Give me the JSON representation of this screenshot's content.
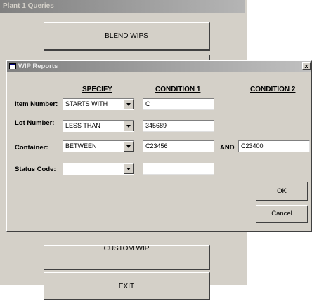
{
  "plant_window": {
    "title": "Plant 1 Queries",
    "buttons": {
      "blend_wips": "BLEND WIPS",
      "custom_wip": "CUSTOM WIP",
      "exit": "EXIT"
    }
  },
  "wip_window": {
    "title": "WIP Reports",
    "close_glyph": "x",
    "headers": {
      "specify": "SPECIFY",
      "condition1": "CONDITION 1",
      "condition2": "CONDITION 2"
    },
    "rows": [
      {
        "label": "Item Number:",
        "specify": "STARTS WITH",
        "condition1": "C",
        "condition2": ""
      },
      {
        "label": "Lot Number:",
        "specify": "LESS THAN",
        "condition1": "345689",
        "condition2": ""
      },
      {
        "label": "Container:",
        "specify": "BETWEEN",
        "condition1": "C23456",
        "condition2": "C23400"
      },
      {
        "label": "Status Code:",
        "specify": "",
        "condition1": "",
        "condition2": ""
      }
    ],
    "and_label": "AND",
    "ok_label": "OK",
    "cancel_label": "Cancel"
  }
}
